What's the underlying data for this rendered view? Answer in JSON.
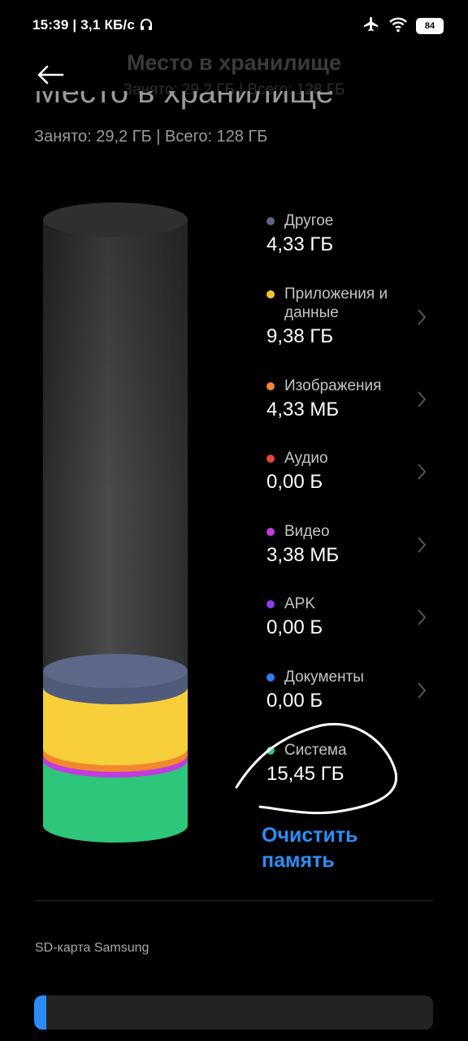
{
  "status_bar": {
    "time": "15:39 | 3,1 КБ/с",
    "battery": "84"
  },
  "header": {
    "title": "Место в хранилище",
    "subtitle": "Занято: 29,2 ГБ | Всего: 128 ГБ"
  },
  "page": {
    "title": "Место в хранилище",
    "subtitle": "Занято: 29,2 ГБ | Всего: 128 ГБ"
  },
  "categories": [
    {
      "label": "Другое",
      "value": "4,33 ГБ",
      "color": "#5b6688",
      "chevron": false
    },
    {
      "label": "Приложения и данные",
      "value": "9,38 ГБ",
      "color": "#f4c430",
      "chevron": true
    },
    {
      "label": "Изображения",
      "value": "4,33 МБ",
      "color": "#f2872c",
      "chevron": true
    },
    {
      "label": "Аудио",
      "value": "0,00 Б",
      "color": "#e5453a",
      "chevron": true
    },
    {
      "label": "Видео",
      "value": "3,38 МБ",
      "color": "#c23be0",
      "chevron": true
    },
    {
      "label": "APK",
      "value": "0,00 Б",
      "color": "#8c3ce8",
      "chevron": true
    },
    {
      "label": "Документы",
      "value": "0,00 Б",
      "color": "#2d7ff2",
      "chevron": true
    },
    {
      "label": "Система",
      "value": "15,45 ГБ",
      "color": "#2ec67a",
      "chevron": false
    }
  ],
  "clean_button": "Очистить память",
  "sd_card": {
    "label": "SD-карта Samsung",
    "used_fraction": 0.03,
    "accent": "#2a8cf7"
  }
}
